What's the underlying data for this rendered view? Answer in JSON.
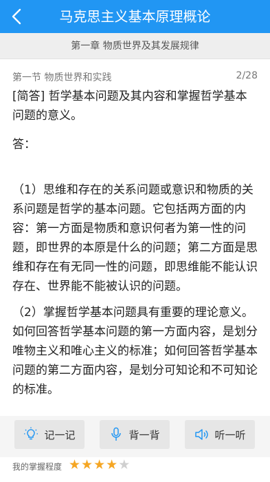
{
  "app": {
    "title": "马克思主义基本原理概论",
    "back_icon": "chevron-left-icon"
  },
  "chapter": {
    "title": "第一章 物质世界及其发展规律"
  },
  "section": {
    "title": "第一节 物质世界和实践",
    "counter": "2/28"
  },
  "question": {
    "tag": "[简答]",
    "text": "哲学基本问题及其内容和掌握哲学基本问题的意义。"
  },
  "answer": {
    "label": "答：",
    "paragraphs": [
      "（1）思维和存在的关系问题或意识和物质的关系问题是哲学的基本问题。它包括两方面的内容：第一方面是物质和意识何者为第一性的问题，即世界的本原是什么的问题；第二方面是思维和存在有无同一性的问题，即思维能不能认识存在、世界能不能被认识的问题。",
      "（2）掌握哲学基本问题具有重要的理论意义。如何回答哲学基本问题的第一方面内容，是划分唯物主义和唯心主义的标准；如何回答哲学基本问题的第二方面内容，是划分可知论和不可知论的标准。"
    ]
  },
  "actions": [
    {
      "label": "记一记",
      "icon": "lightbulb-icon"
    },
    {
      "label": "背一背",
      "icon": "microphone-icon"
    },
    {
      "label": "听一听",
      "icon": "speaker-icon"
    }
  ],
  "mastery": {
    "label": "我的掌握程度",
    "rating": 4,
    "max": 5
  },
  "colors": {
    "accent": "#2196f3",
    "icon_blue": "#2196f3",
    "star_on": "#f5a623",
    "star_off": "#cfcfcf"
  }
}
